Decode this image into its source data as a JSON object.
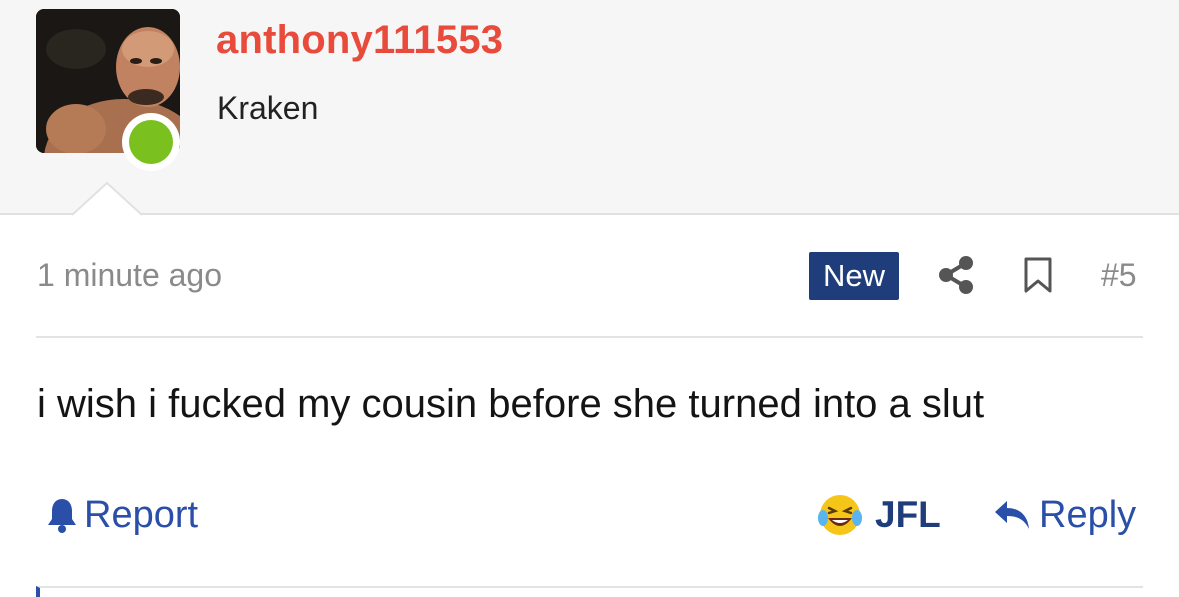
{
  "user": {
    "username": "anthony111553",
    "title": "Kraken",
    "status": "online"
  },
  "post": {
    "timestamp": "1 minute ago",
    "badge": "New",
    "number": "#5",
    "body": "i wish i fucked my cousin before she turned into a slut"
  },
  "actions": {
    "report_label": "Report",
    "reaction_label": "JFL",
    "reply_label": "Reply"
  },
  "icons": {
    "share": "share-icon",
    "bookmark": "bookmark-icon",
    "report": "bell-icon",
    "reaction": "laughing-tears-emoji-icon",
    "reply": "reply-arrow-icon"
  },
  "colors": {
    "username": "#e84a3b",
    "badge_bg": "#1f3d7a",
    "link": "#2a4fa8",
    "online": "#7ac01e"
  }
}
